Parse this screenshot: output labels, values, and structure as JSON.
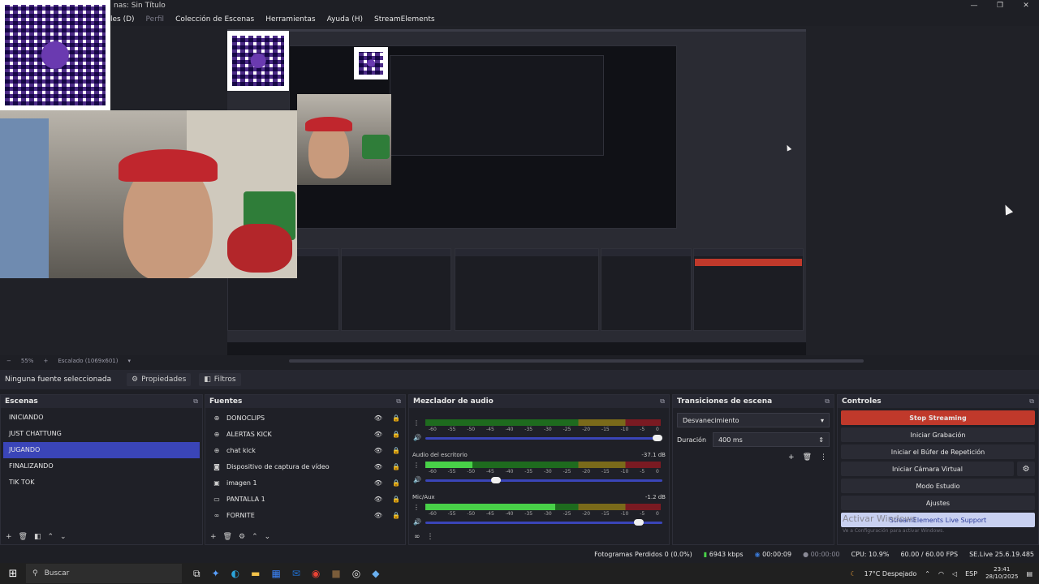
{
  "window": {
    "title": "nas: Sin Título",
    "controls": [
      "—",
      "❐",
      "✕"
    ]
  },
  "menu": [
    {
      "label": "les (D)",
      "dim": false
    },
    {
      "label": "Perfil",
      "dim": true
    },
    {
      "label": "Colección de Escenas",
      "dim": false
    },
    {
      "label": "Herramientas",
      "dim": false
    },
    {
      "label": "Ayuda (H)",
      "dim": false
    },
    {
      "label": "StreamElements",
      "dim": false
    }
  ],
  "preview": {
    "zoom": "55%",
    "scale": "Escalado (1069x601)"
  },
  "source_toolbar": {
    "no_source": "Ninguna fuente seleccionada",
    "properties": "Propiedades",
    "filters": "Filtros"
  },
  "scenes": {
    "title": "Escenas",
    "items": [
      "INICIANDO",
      "JUST CHATTUNG",
      "JUGANDO",
      "FINALIZANDO",
      "TIK TOK"
    ],
    "selected_index": 2
  },
  "sources": {
    "title": "Fuentes",
    "items": [
      {
        "icon": "globe-icon",
        "glyph": "⊕",
        "label": "DONOCLIPS"
      },
      {
        "icon": "globe-icon",
        "glyph": "⊕",
        "label": "ALERTAS KICK"
      },
      {
        "icon": "globe-icon",
        "glyph": "⊕",
        "label": "chat kick"
      },
      {
        "icon": "camera-icon",
        "glyph": "◙",
        "label": "Dispositivo de captura de vídeo"
      },
      {
        "icon": "image-icon",
        "glyph": "▣",
        "label": "imagen 1"
      },
      {
        "icon": "monitor-icon",
        "glyph": "▭",
        "label": "PANTALLA 1"
      },
      {
        "icon": "link-icon",
        "glyph": "∞",
        "label": "FORNITE"
      }
    ]
  },
  "mixer": {
    "title": "Mezclador de audio",
    "ticks": [
      "-60",
      "-55",
      "-50",
      "-45",
      "-40",
      "-35",
      "-30",
      "-25",
      "-20",
      "-15",
      "-10",
      "-5",
      "0"
    ],
    "tracks": [
      {
        "name": "",
        "db": "",
        "level": 0.0,
        "volume": 1.0
      },
      {
        "name": "Audio del escritorio",
        "db": "-37.1 dB",
        "level": 0.2,
        "volume": 0.32
      },
      {
        "name": "Mic/Aux",
        "db": "-1.2 dB",
        "level": 0.55,
        "volume": 0.92
      }
    ]
  },
  "transitions": {
    "title": "Transiciones de escena",
    "selected": "Desvanecimiento",
    "duration_label": "Duración",
    "duration_value": "400 ms"
  },
  "controls": {
    "title": "Controles",
    "stop_streaming": "Stop Streaming",
    "start_recording": "Iniciar Grabación",
    "replay_buffer": "Iniciar el Búfer de Repetición",
    "virtual_cam": "Iniciar Cámara Virtual",
    "studio_mode": "Modo Estudio",
    "settings": "Ajustes",
    "support": "StreamElements Live Support",
    "watermark": "Activar Windows",
    "watermark_sub": "Ve a Configuración para activar Windows."
  },
  "statusbar": {
    "dropped": "Fotogramas Perdidos 0 (0.0%)",
    "bitrate": "6943 kbps",
    "stream_time": "00:00:09",
    "rec_time": "00:00:00",
    "cpu": "CPU: 10.9%",
    "fps": "60.00 / 60.00 FPS",
    "version": "SE.Live 25.6.19.485"
  },
  "taskbar": {
    "search": "Buscar",
    "weather": "17°C  Despejado",
    "lang": "ESP",
    "time": "23:41",
    "date": "28/10/2025"
  },
  "colors": {
    "accent": "#3a45b8",
    "stop": "#c0392b"
  }
}
